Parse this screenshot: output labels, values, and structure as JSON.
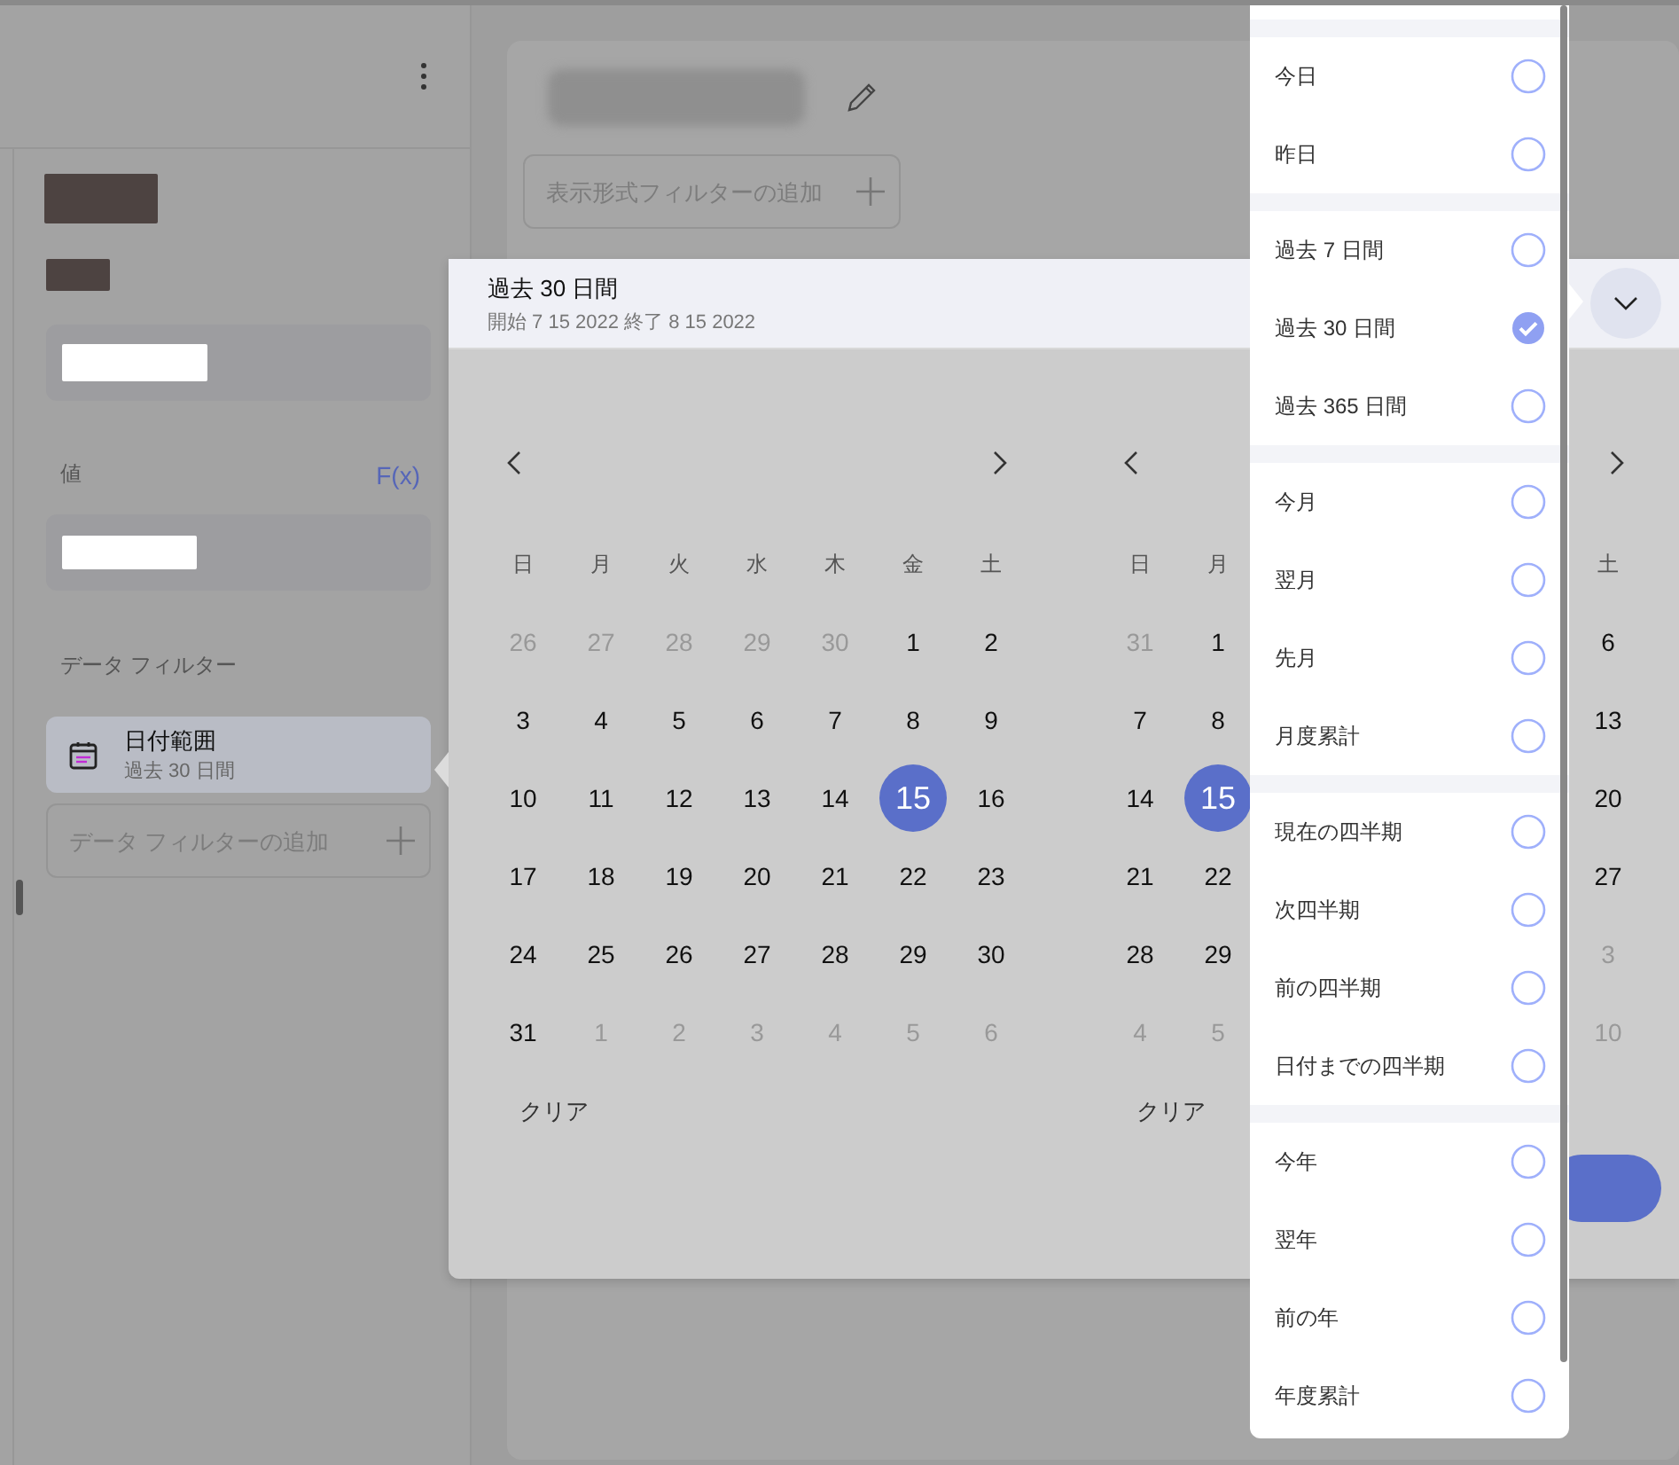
{
  "sidebar": {
    "value_label": "値",
    "fx_button": "F(x)",
    "filters_heading": "データ フィルター",
    "filters": [
      {
        "title": "日付範囲",
        "subtitle": "過去 30 日間",
        "selected": true
      }
    ],
    "add_filter_placeholder": "データ フィルターの追加"
  },
  "card": {
    "add_format_filter_placeholder": "表示形式フィルターの追加"
  },
  "date_popup": {
    "title": "過去 30 日間",
    "range": "開始 7 15 2022 終了 8 15 2022",
    "calendars": [
      {
        "weekdays": [
          "日",
          "月",
          "火",
          "水",
          "木",
          "金",
          "土"
        ],
        "clear": "クリア",
        "weeks": [
          [
            {
              "d": "26",
              "other_month": true,
              "selected": false
            },
            {
              "d": "27",
              "other_month": true,
              "selected": false
            },
            {
              "d": "28",
              "other_month": true,
              "selected": false
            },
            {
              "d": "29",
              "other_month": true,
              "selected": false
            },
            {
              "d": "30",
              "other_month": true,
              "selected": false
            },
            {
              "d": "1",
              "other_month": false,
              "selected": false
            },
            {
              "d": "2",
              "other_month": false,
              "selected": false
            }
          ],
          [
            {
              "d": "3",
              "other_month": false,
              "selected": false
            },
            {
              "d": "4",
              "other_month": false,
              "selected": false
            },
            {
              "d": "5",
              "other_month": false,
              "selected": false
            },
            {
              "d": "6",
              "other_month": false,
              "selected": false
            },
            {
              "d": "7",
              "other_month": false,
              "selected": false
            },
            {
              "d": "8",
              "other_month": false,
              "selected": false
            },
            {
              "d": "9",
              "other_month": false,
              "selected": false
            }
          ],
          [
            {
              "d": "10",
              "other_month": false,
              "selected": false
            },
            {
              "d": "11",
              "other_month": false,
              "selected": false
            },
            {
              "d": "12",
              "other_month": false,
              "selected": false
            },
            {
              "d": "13",
              "other_month": false,
              "selected": false
            },
            {
              "d": "14",
              "other_month": false,
              "selected": false
            },
            {
              "d": "15",
              "other_month": false,
              "selected": true
            },
            {
              "d": "16",
              "other_month": false,
              "selected": false
            }
          ],
          [
            {
              "d": "17",
              "other_month": false,
              "selected": false
            },
            {
              "d": "18",
              "other_month": false,
              "selected": false
            },
            {
              "d": "19",
              "other_month": false,
              "selected": false
            },
            {
              "d": "20",
              "other_month": false,
              "selected": false
            },
            {
              "d": "21",
              "other_month": false,
              "selected": false
            },
            {
              "d": "22",
              "other_month": false,
              "selected": false
            },
            {
              "d": "23",
              "other_month": false,
              "selected": false
            }
          ],
          [
            {
              "d": "24",
              "other_month": false,
              "selected": false
            },
            {
              "d": "25",
              "other_month": false,
              "selected": false
            },
            {
              "d": "26",
              "other_month": false,
              "selected": false
            },
            {
              "d": "27",
              "other_month": false,
              "selected": false
            },
            {
              "d": "28",
              "other_month": false,
              "selected": false
            },
            {
              "d": "29",
              "other_month": false,
              "selected": false
            },
            {
              "d": "30",
              "other_month": false,
              "selected": false
            }
          ],
          [
            {
              "d": "31",
              "other_month": false,
              "selected": false
            },
            {
              "d": "1",
              "other_month": true,
              "selected": false
            },
            {
              "d": "2",
              "other_month": true,
              "selected": false
            },
            {
              "d": "3",
              "other_month": true,
              "selected": false
            },
            {
              "d": "4",
              "other_month": true,
              "selected": false
            },
            {
              "d": "5",
              "other_month": true,
              "selected": false
            },
            {
              "d": "6",
              "other_month": true,
              "selected": false
            }
          ]
        ]
      },
      {
        "weekdays": [
          "日",
          "月"
        ],
        "weekdays_end": [
          "土"
        ],
        "clear": "クリア",
        "weeks": [
          [
            {
              "d": "31",
              "other_month": true,
              "selected": false
            },
            {
              "d": "1",
              "other_month": false,
              "selected": false
            }
          ],
          [
            {
              "d": "7",
              "other_month": false,
              "selected": false
            },
            {
              "d": "8",
              "other_month": false,
              "selected": false
            }
          ],
          [
            {
              "d": "14",
              "other_month": false,
              "selected": false
            },
            {
              "d": "15",
              "other_month": false,
              "selected": true
            }
          ],
          [
            {
              "d": "21",
              "other_month": false,
              "selected": false
            },
            {
              "d": "22",
              "other_month": false,
              "selected": false
            }
          ],
          [
            {
              "d": "28",
              "other_month": false,
              "selected": false
            },
            {
              "d": "29",
              "other_month": false,
              "selected": false
            }
          ],
          [
            {
              "d": "4",
              "other_month": true,
              "selected": false
            },
            {
              "d": "5",
              "other_month": true,
              "selected": false
            }
          ]
        ],
        "weeks_end": [
          [
            {
              "d": "6",
              "other_month": false,
              "selected": false
            }
          ],
          [
            {
              "d": "13",
              "other_month": false,
              "selected": false
            }
          ],
          [
            {
              "d": "20",
              "other_month": false,
              "selected": false
            }
          ],
          [
            {
              "d": "27",
              "other_month": false,
              "selected": false
            }
          ],
          [
            {
              "d": "3",
              "other_month": true,
              "selected": false
            }
          ],
          [
            {
              "d": "10",
              "other_month": true,
              "selected": false
            }
          ]
        ]
      }
    ]
  },
  "presets": {
    "groups": [
      {
        "items": [
          {
            "label": "今日",
            "selected": false
          },
          {
            "label": "昨日",
            "selected": false
          }
        ]
      },
      {
        "items": [
          {
            "label": "過去 7 日間",
            "selected": false
          },
          {
            "label": "過去 30 日間",
            "selected": true
          },
          {
            "label": "過去 365 日間",
            "selected": false
          }
        ]
      },
      {
        "items": [
          {
            "label": "今月",
            "selected": false
          },
          {
            "label": "翌月",
            "selected": false
          },
          {
            "label": "先月",
            "selected": false
          },
          {
            "label": "月度累計",
            "selected": false
          }
        ]
      },
      {
        "items": [
          {
            "label": "現在の四半期",
            "selected": false
          },
          {
            "label": "次四半期",
            "selected": false
          },
          {
            "label": "前の四半期",
            "selected": false
          },
          {
            "label": "日付までの四半期",
            "selected": false
          }
        ]
      },
      {
        "items": [
          {
            "label": "今年",
            "selected": false
          },
          {
            "label": "翌年",
            "selected": false
          },
          {
            "label": "前の年",
            "selected": false
          },
          {
            "label": "年度累計",
            "selected": false
          }
        ]
      }
    ]
  }
}
